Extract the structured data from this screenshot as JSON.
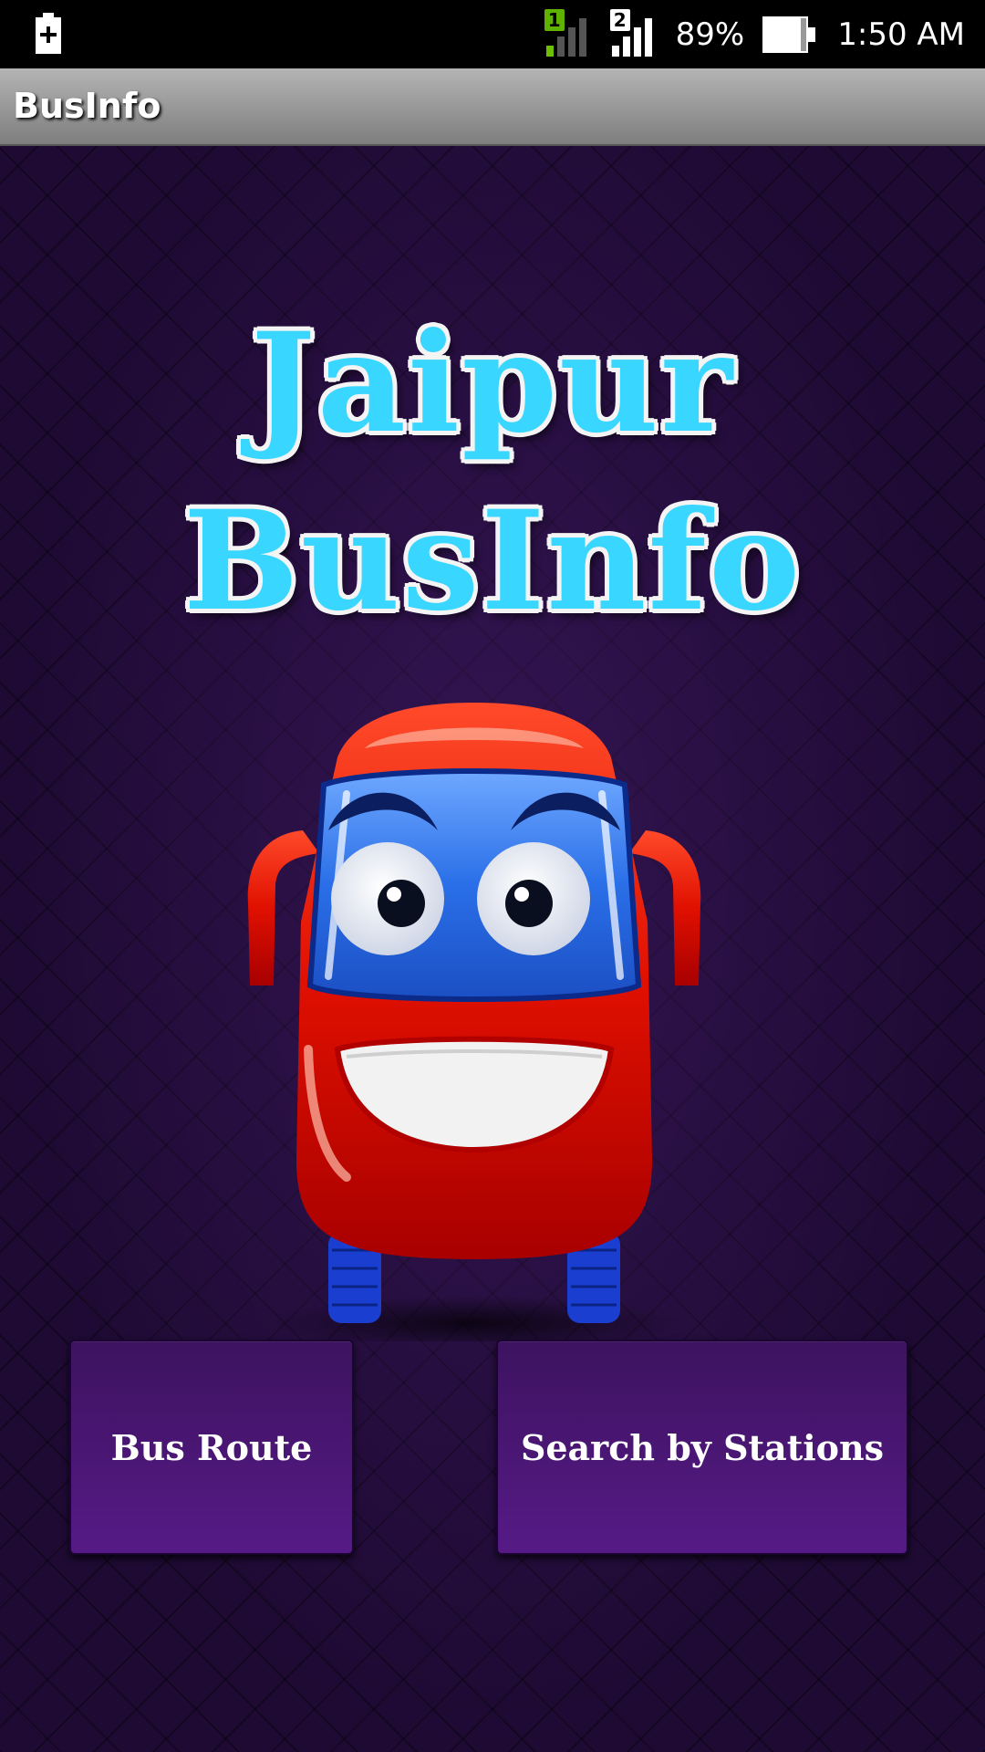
{
  "status_bar": {
    "sim1": "1",
    "sim2": "2",
    "battery": "89%",
    "time": "1:50 AM"
  },
  "action_bar": {
    "title": "BusInfo"
  },
  "logo": {
    "line1": "Jaipur",
    "line2": "BusInfo"
  },
  "buttons": {
    "bus_route": "Bus Route",
    "search_stations": "Search by Stations"
  },
  "colors": {
    "logo_text": "#39d6ff",
    "background": "#1e0a33",
    "button": "#4d1878"
  }
}
